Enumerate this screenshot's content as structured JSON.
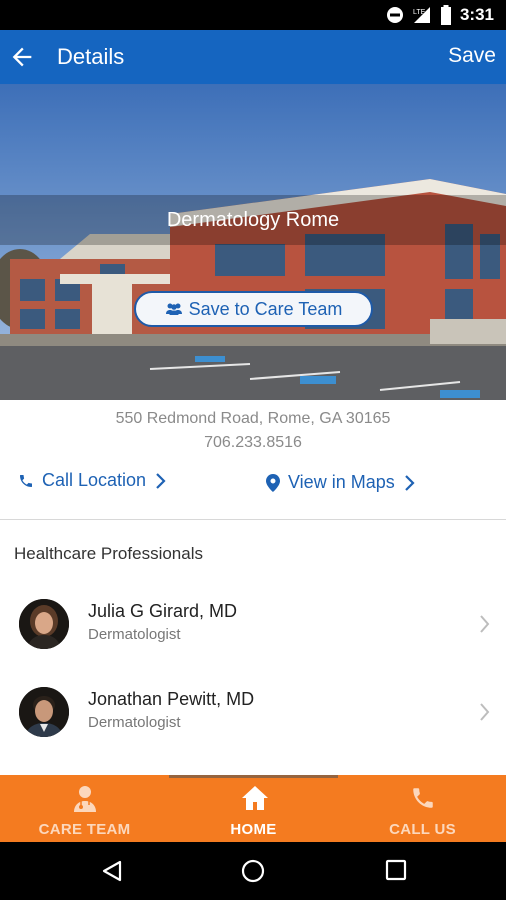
{
  "status_bar": {
    "time": "3:31",
    "network": "LTE"
  },
  "app_bar": {
    "title": "Details",
    "save_label": "Save"
  },
  "location": {
    "name": "Dermatology Rome",
    "save_team_label": "Save to Care Team",
    "address": "550 Redmond Road, Rome, GA 30165",
    "phone": "706.233.8516",
    "call_label": "Call Location",
    "maps_label": "View in Maps"
  },
  "professionals": {
    "section_title": "Healthcare Professionals",
    "items": [
      {
        "name": "Julia G Girard, MD",
        "specialty": "Dermatologist"
      },
      {
        "name": "Jonathan Pewitt, MD",
        "specialty": "Dermatologist"
      }
    ]
  },
  "bottom_nav": {
    "items": [
      {
        "label": "CARE TEAM",
        "icon": "doctor-icon"
      },
      {
        "label": "HOME",
        "icon": "home-icon"
      },
      {
        "label": "CALL US",
        "icon": "phone-icon"
      }
    ],
    "active": "HOME"
  },
  "colors": {
    "primary": "#1565c0",
    "accent": "#f47b20",
    "link": "#1e62b4"
  }
}
